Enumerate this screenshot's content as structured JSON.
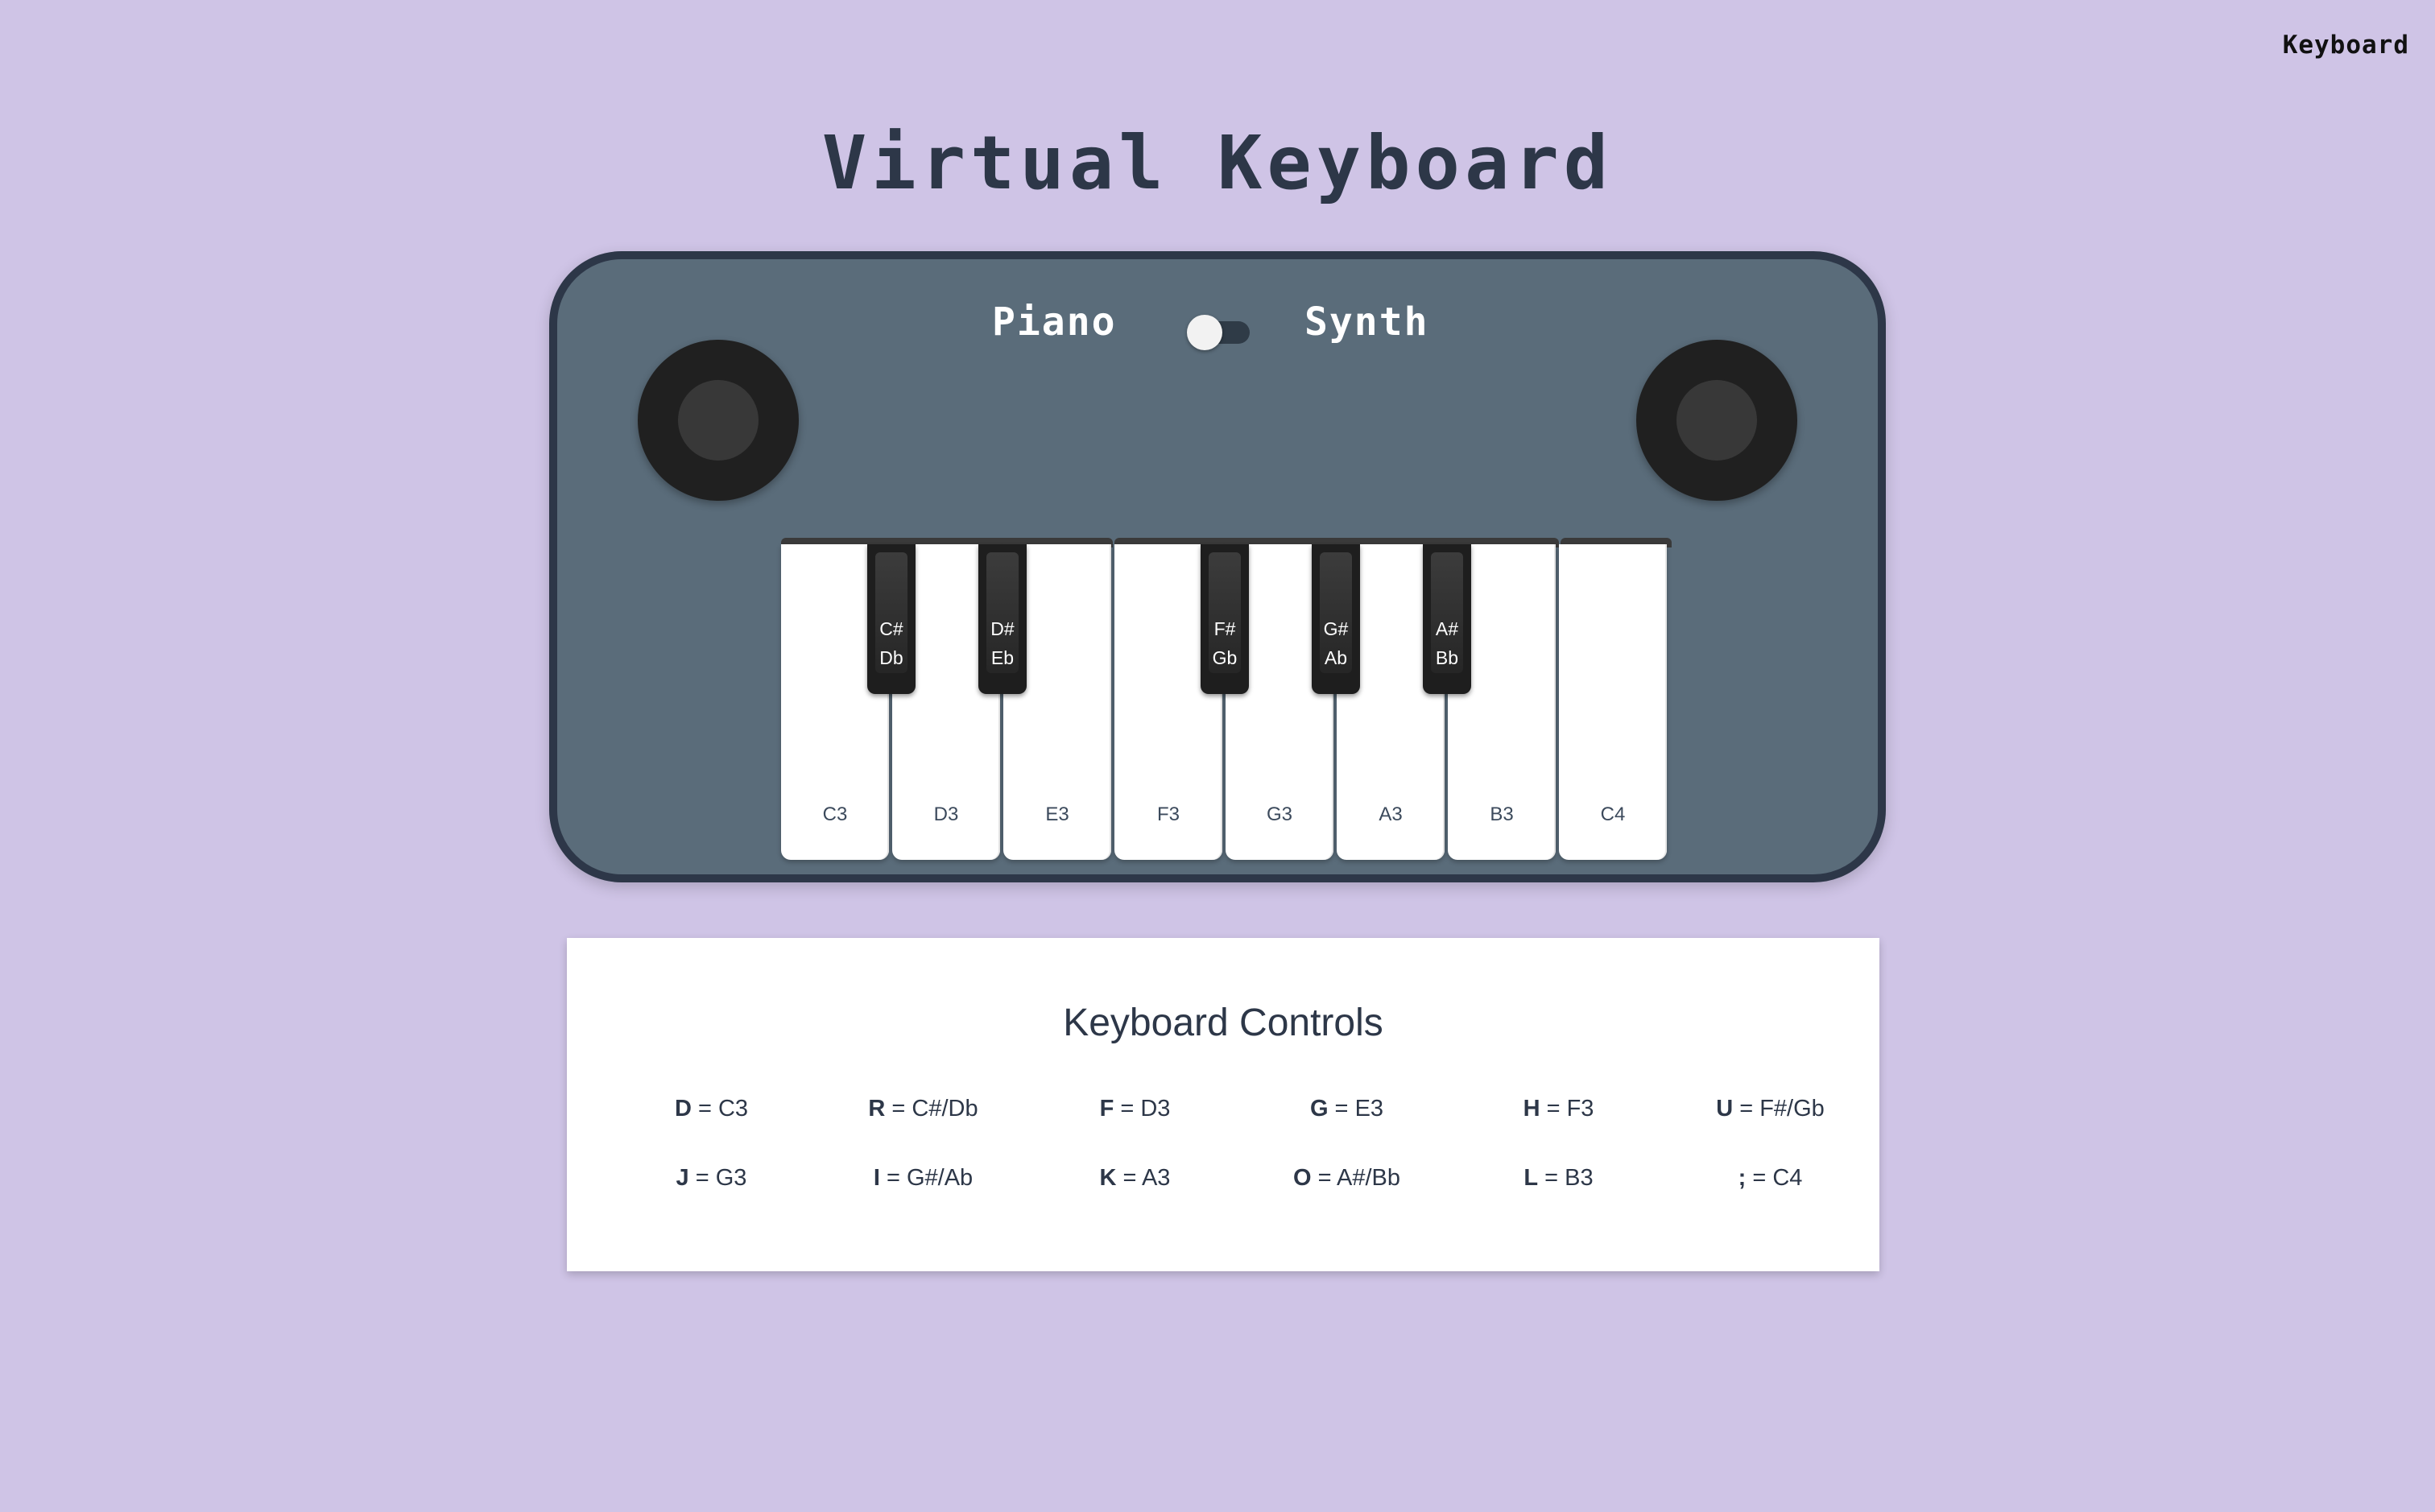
{
  "nav": {
    "link": "Keyboard"
  },
  "title": "Virtual Keyboard",
  "mode": {
    "left": "Piano",
    "right": "Synth",
    "selected": "Piano"
  },
  "white_keys": [
    "C3",
    "D3",
    "E3",
    "F3",
    "G3",
    "A3",
    "B3",
    "C4"
  ],
  "black_keys": [
    {
      "sharp": "C#",
      "flat": "Db"
    },
    {
      "sharp": "D#",
      "flat": "Eb"
    },
    {
      "sharp": "F#",
      "flat": "Gb"
    },
    {
      "sharp": "G#",
      "flat": "Ab"
    },
    {
      "sharp": "A#",
      "flat": "Bb"
    }
  ],
  "controls": {
    "title": "Keyboard Controls",
    "items": [
      {
        "key": "D",
        "note": "C3"
      },
      {
        "key": "R",
        "note": "C#/Db"
      },
      {
        "key": "F",
        "note": "D3"
      },
      {
        "key": "G",
        "note": "E3"
      },
      {
        "key": "H",
        "note": "F3"
      },
      {
        "key": "U",
        "note": "F#/Gb"
      },
      {
        "key": "J",
        "note": "G3"
      },
      {
        "key": "I",
        "note": "G#/Ab"
      },
      {
        "key": "K",
        "note": "A3"
      },
      {
        "key": "O",
        "note": "A#/Bb"
      },
      {
        "key": "L",
        "note": "B3"
      },
      {
        "key": ";",
        "note": "C4"
      }
    ]
  },
  "colors": {
    "background": "#cfc4e6",
    "keyboard_body": "#5a6c7a",
    "keyboard_border": "#2d3748",
    "text_dark": "#2d3748"
  }
}
